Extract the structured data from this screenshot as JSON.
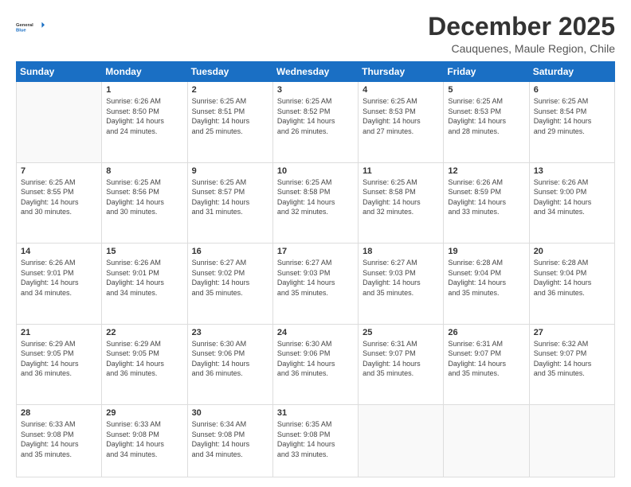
{
  "logo": {
    "line1": "General",
    "line2": "Blue"
  },
  "title": "December 2025",
  "subtitle": "Cauquenes, Maule Region, Chile",
  "days_header": [
    "Sunday",
    "Monday",
    "Tuesday",
    "Wednesday",
    "Thursday",
    "Friday",
    "Saturday"
  ],
  "weeks": [
    [
      {
        "day": "",
        "info": ""
      },
      {
        "day": "1",
        "info": "Sunrise: 6:26 AM\nSunset: 8:50 PM\nDaylight: 14 hours\nand 24 minutes."
      },
      {
        "day": "2",
        "info": "Sunrise: 6:25 AM\nSunset: 8:51 PM\nDaylight: 14 hours\nand 25 minutes."
      },
      {
        "day": "3",
        "info": "Sunrise: 6:25 AM\nSunset: 8:52 PM\nDaylight: 14 hours\nand 26 minutes."
      },
      {
        "day": "4",
        "info": "Sunrise: 6:25 AM\nSunset: 8:53 PM\nDaylight: 14 hours\nand 27 minutes."
      },
      {
        "day": "5",
        "info": "Sunrise: 6:25 AM\nSunset: 8:53 PM\nDaylight: 14 hours\nand 28 minutes."
      },
      {
        "day": "6",
        "info": "Sunrise: 6:25 AM\nSunset: 8:54 PM\nDaylight: 14 hours\nand 29 minutes."
      }
    ],
    [
      {
        "day": "7",
        "info": "Sunrise: 6:25 AM\nSunset: 8:55 PM\nDaylight: 14 hours\nand 30 minutes."
      },
      {
        "day": "8",
        "info": "Sunrise: 6:25 AM\nSunset: 8:56 PM\nDaylight: 14 hours\nand 30 minutes."
      },
      {
        "day": "9",
        "info": "Sunrise: 6:25 AM\nSunset: 8:57 PM\nDaylight: 14 hours\nand 31 minutes."
      },
      {
        "day": "10",
        "info": "Sunrise: 6:25 AM\nSunset: 8:58 PM\nDaylight: 14 hours\nand 32 minutes."
      },
      {
        "day": "11",
        "info": "Sunrise: 6:25 AM\nSunset: 8:58 PM\nDaylight: 14 hours\nand 32 minutes."
      },
      {
        "day": "12",
        "info": "Sunrise: 6:26 AM\nSunset: 8:59 PM\nDaylight: 14 hours\nand 33 minutes."
      },
      {
        "day": "13",
        "info": "Sunrise: 6:26 AM\nSunset: 9:00 PM\nDaylight: 14 hours\nand 34 minutes."
      }
    ],
    [
      {
        "day": "14",
        "info": "Sunrise: 6:26 AM\nSunset: 9:01 PM\nDaylight: 14 hours\nand 34 minutes."
      },
      {
        "day": "15",
        "info": "Sunrise: 6:26 AM\nSunset: 9:01 PM\nDaylight: 14 hours\nand 34 minutes."
      },
      {
        "day": "16",
        "info": "Sunrise: 6:27 AM\nSunset: 9:02 PM\nDaylight: 14 hours\nand 35 minutes."
      },
      {
        "day": "17",
        "info": "Sunrise: 6:27 AM\nSunset: 9:03 PM\nDaylight: 14 hours\nand 35 minutes."
      },
      {
        "day": "18",
        "info": "Sunrise: 6:27 AM\nSunset: 9:03 PM\nDaylight: 14 hours\nand 35 minutes."
      },
      {
        "day": "19",
        "info": "Sunrise: 6:28 AM\nSunset: 9:04 PM\nDaylight: 14 hours\nand 35 minutes."
      },
      {
        "day": "20",
        "info": "Sunrise: 6:28 AM\nSunset: 9:04 PM\nDaylight: 14 hours\nand 36 minutes."
      }
    ],
    [
      {
        "day": "21",
        "info": "Sunrise: 6:29 AM\nSunset: 9:05 PM\nDaylight: 14 hours\nand 36 minutes."
      },
      {
        "day": "22",
        "info": "Sunrise: 6:29 AM\nSunset: 9:05 PM\nDaylight: 14 hours\nand 36 minutes."
      },
      {
        "day": "23",
        "info": "Sunrise: 6:30 AM\nSunset: 9:06 PM\nDaylight: 14 hours\nand 36 minutes."
      },
      {
        "day": "24",
        "info": "Sunrise: 6:30 AM\nSunset: 9:06 PM\nDaylight: 14 hours\nand 36 minutes."
      },
      {
        "day": "25",
        "info": "Sunrise: 6:31 AM\nSunset: 9:07 PM\nDaylight: 14 hours\nand 35 minutes."
      },
      {
        "day": "26",
        "info": "Sunrise: 6:31 AM\nSunset: 9:07 PM\nDaylight: 14 hours\nand 35 minutes."
      },
      {
        "day": "27",
        "info": "Sunrise: 6:32 AM\nSunset: 9:07 PM\nDaylight: 14 hours\nand 35 minutes."
      }
    ],
    [
      {
        "day": "28",
        "info": "Sunrise: 6:33 AM\nSunset: 9:08 PM\nDaylight: 14 hours\nand 35 minutes."
      },
      {
        "day": "29",
        "info": "Sunrise: 6:33 AM\nSunset: 9:08 PM\nDaylight: 14 hours\nand 34 minutes."
      },
      {
        "day": "30",
        "info": "Sunrise: 6:34 AM\nSunset: 9:08 PM\nDaylight: 14 hours\nand 34 minutes."
      },
      {
        "day": "31",
        "info": "Sunrise: 6:35 AM\nSunset: 9:08 PM\nDaylight: 14 hours\nand 33 minutes."
      },
      {
        "day": "",
        "info": ""
      },
      {
        "day": "",
        "info": ""
      },
      {
        "day": "",
        "info": ""
      }
    ]
  ]
}
